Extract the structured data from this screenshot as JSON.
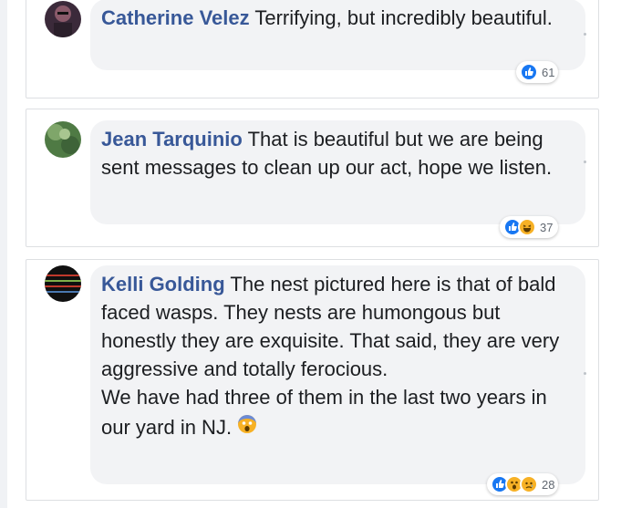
{
  "comments": [
    {
      "author": "Catherine Velez",
      "text": "Terrifying, but incredibly beautiful.",
      "reactions": [
        "like-icon"
      ],
      "reaction_count": "61"
    },
    {
      "author": "Jean Tarquinio",
      "text": "That is beautiful but we are being sent messages to clean up our act, hope we listen.",
      "reactions": [
        "like-icon",
        "haha-icon"
      ],
      "reaction_count": "37"
    },
    {
      "author": "Kelli Golding",
      "text_line1": "The nest pictured here is that of bald faced wasps. They nests are humongous but honestly they are exquisite. That said, they are very aggressive and totally ferocious.",
      "text_line2": "We have had three of them in the last two years in our yard in NJ.",
      "inline_emoji": "screaming-face-emoji",
      "reactions": [
        "like-icon",
        "wow-icon",
        "sad-icon"
      ],
      "reaction_count": "28"
    }
  ],
  "colors": {
    "author": "#385898",
    "bubble": "#f2f3f5",
    "like": "#1877f2",
    "emoji_yellow": "#f7b125"
  }
}
